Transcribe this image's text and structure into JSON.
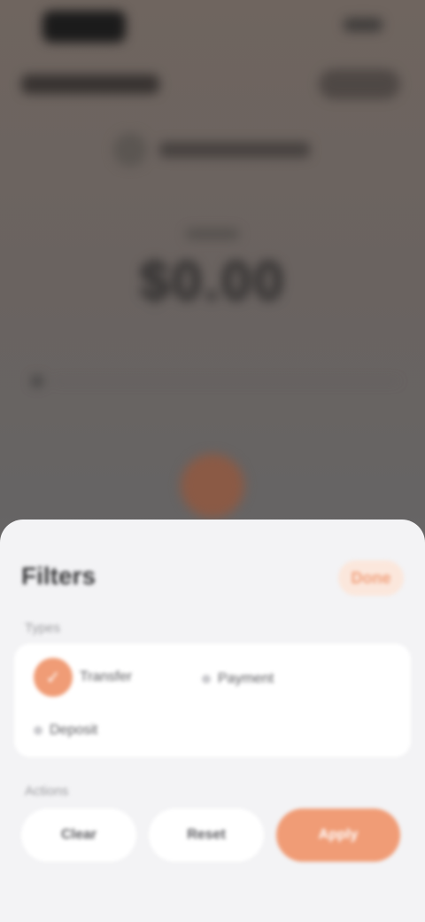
{
  "background": {
    "status_time": "",
    "header_title": "",
    "account_name": "",
    "balance_label": "",
    "balance_amount": "$0.00"
  },
  "sheet": {
    "title": "Filters",
    "close_label": "Done",
    "types_label": "Types",
    "types": [
      {
        "label": "Transfer",
        "icon": "check-icon",
        "selected": true
      },
      {
        "label": "Payment",
        "icon": "dot-icon",
        "selected": false
      },
      {
        "label": "Deposit",
        "icon": "dot-icon",
        "selected": false
      }
    ],
    "actions_label": "Actions",
    "actions": [
      {
        "label": "Clear"
      },
      {
        "label": "Reset"
      },
      {
        "label": "Apply"
      }
    ]
  },
  "colors": {
    "accent": "#f09c76",
    "accent_soft": "#fbe7dc",
    "sheet_bg": "#f3f3f5",
    "card_bg": "#ffffff"
  }
}
